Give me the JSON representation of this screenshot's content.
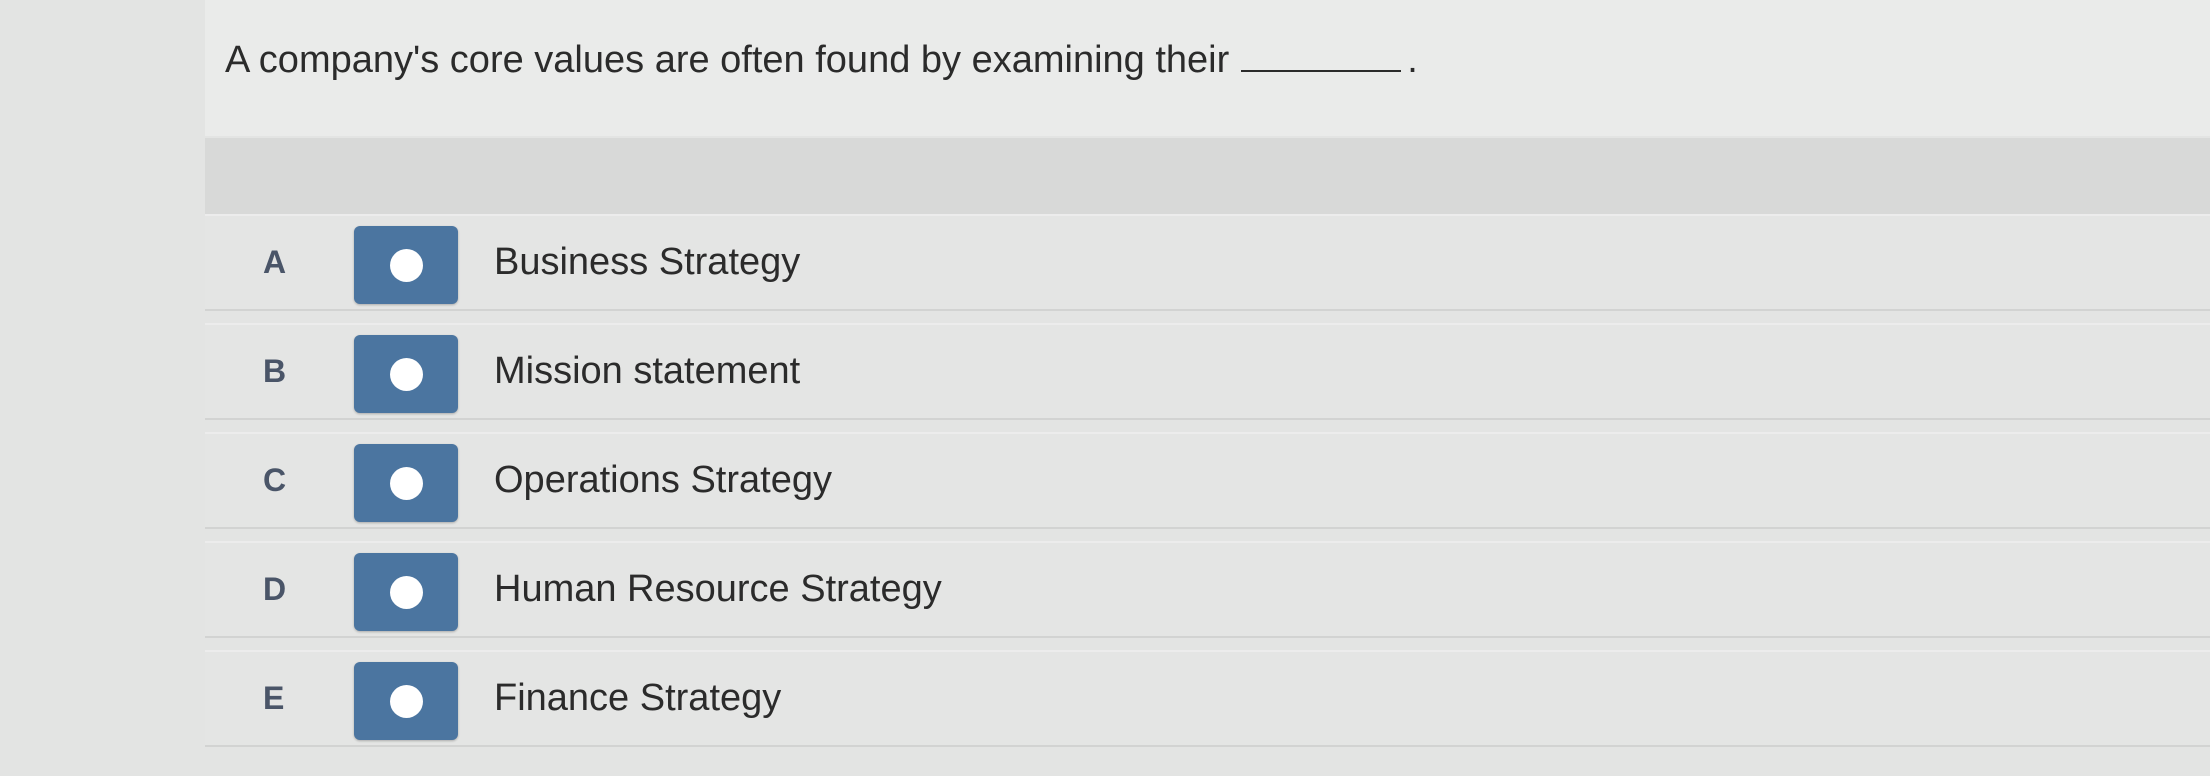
{
  "question": {
    "text": "A company's core values are often found by examining their",
    "suffix": "."
  },
  "options": [
    {
      "letter": "A",
      "label": "Business Strategy",
      "selected": false
    },
    {
      "letter": "B",
      "label": "Mission statement",
      "selected": false
    },
    {
      "letter": "C",
      "label": "Operations Strategy",
      "selected": false
    },
    {
      "letter": "D",
      "label": "Human Resource Strategy",
      "selected": false
    },
    {
      "letter": "E",
      "label": "Finance Strategy",
      "selected": false
    }
  ],
  "colors": {
    "radio_fill": "#4b75a0",
    "radio_dot": "#ffffff",
    "letter": "#4a5568",
    "text": "#2b2b2b",
    "background": "#e3e4e3"
  }
}
